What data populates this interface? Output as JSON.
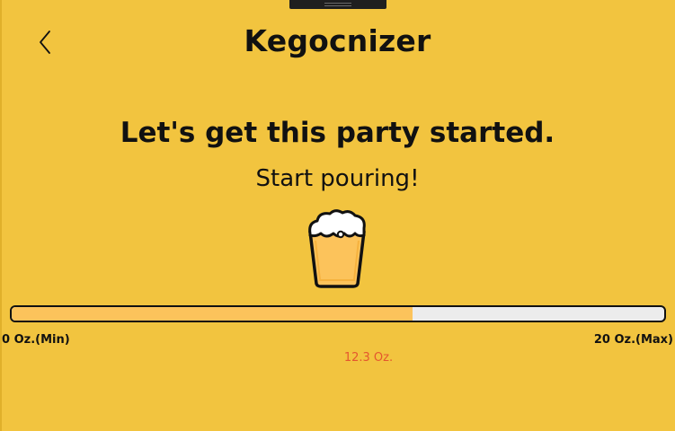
{
  "app": {
    "title": "Kegocnizer"
  },
  "nav": {
    "back_icon": "chevron-left-icon"
  },
  "content": {
    "headline": "Let's get this party started.",
    "subline": "Start pouring!",
    "illustration_icon": "beer-glass-icon"
  },
  "pour_meter": {
    "min_label": "0 Oz.(Min)",
    "max_label": "20 Oz.(Max)",
    "current_label": "12.3 Oz.",
    "current_oz": 12.3,
    "max_oz": 20,
    "min_oz": 0,
    "fill_fraction": 0.615
  },
  "colors": {
    "background": "#f2c43f",
    "fill": "#fcc35b",
    "track": "#ececec",
    "value_text": "#e4572e"
  }
}
